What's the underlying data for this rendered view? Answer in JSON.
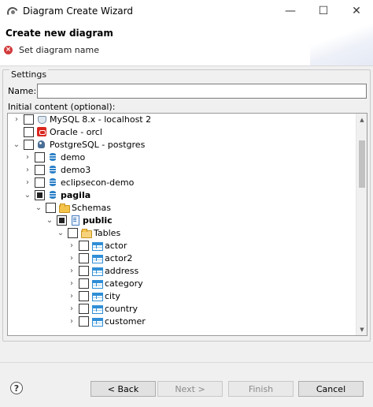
{
  "window": {
    "title": "Diagram Create Wizard",
    "minimize_glyph": "—",
    "maximize_glyph": "☐",
    "close_glyph": "✕"
  },
  "header": {
    "title": "Create new diagram",
    "error_glyph": "×",
    "message": "Set diagram name"
  },
  "settings": {
    "group_label": "Settings",
    "name_label": "Name:",
    "name_value": "",
    "content_label": "Initial content (optional):"
  },
  "tree": {
    "rows": [
      {
        "label": "MySQL 8.x - localhost 2",
        "icon": "mysql-icon",
        "expander": "›",
        "checked": "none",
        "bold": false
      },
      {
        "label": "Oracle - orcl",
        "icon": "oracle-icon",
        "expander": "",
        "checked": "none",
        "bold": false
      },
      {
        "label": "PostgreSQL - postgres",
        "icon": "postgresql-icon",
        "expander": "⌄",
        "checked": "none",
        "bold": false
      },
      {
        "label": "demo",
        "icon": "database-icon",
        "expander": "›",
        "checked": "none",
        "bold": false
      },
      {
        "label": "demo3",
        "icon": "database-icon",
        "expander": "›",
        "checked": "none",
        "bold": false
      },
      {
        "label": "eclipsecon-demo",
        "icon": "database-icon",
        "expander": "›",
        "checked": "none",
        "bold": false
      },
      {
        "label": "pagila",
        "icon": "database-icon",
        "expander": "⌄",
        "checked": "partial",
        "bold": true
      },
      {
        "label": "Schemas",
        "icon": "folder-icon",
        "expander": "⌄",
        "checked": "none",
        "bold": false
      },
      {
        "label": "public",
        "icon": "schema-icon",
        "expander": "⌄",
        "checked": "partial",
        "bold": true
      },
      {
        "label": "Tables",
        "icon": "folder-icon",
        "expander": "⌄",
        "checked": "none",
        "bold": false
      },
      {
        "label": "actor",
        "icon": "table-icon",
        "expander": "›",
        "checked": "none",
        "bold": false
      },
      {
        "label": "actor2",
        "icon": "table-icon",
        "expander": "›",
        "checked": "none",
        "bold": false
      },
      {
        "label": "address",
        "icon": "table-icon",
        "expander": "›",
        "checked": "none",
        "bold": false
      },
      {
        "label": "category",
        "icon": "table-icon",
        "expander": "›",
        "checked": "none",
        "bold": false
      },
      {
        "label": "city",
        "icon": "table-icon",
        "expander": "›",
        "checked": "none",
        "bold": false
      },
      {
        "label": "country",
        "icon": "table-icon",
        "expander": "›",
        "checked": "none",
        "bold": false
      },
      {
        "label": "customer",
        "icon": "table-icon",
        "expander": "›",
        "checked": "none",
        "bold": false
      }
    ],
    "scroll_up_glyph": "▲",
    "scroll_down_glyph": "▼"
  },
  "buttons": {
    "help": "?",
    "back": "< Back",
    "next": "Next >",
    "finish": "Finish",
    "cancel": "Cancel"
  }
}
